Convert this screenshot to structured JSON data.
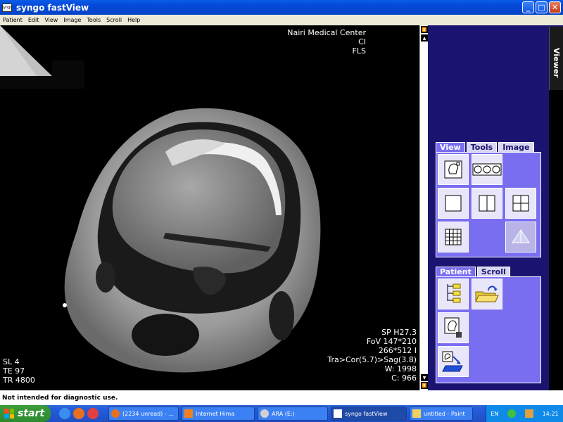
{
  "window": {
    "title": "syngo fastView",
    "icon_label": "syngo"
  },
  "window_controls": {
    "minimize": "_",
    "maximize": "□",
    "close": "✕"
  },
  "menu": [
    "Patient",
    "Edit",
    "View",
    "Image",
    "Tools",
    "Scroll",
    "Help"
  ],
  "overlay": {
    "top_right": [
      "Nairi Medical Center",
      "CI",
      "FLS"
    ],
    "bottom_left": [
      "SL 4",
      "TE 97",
      "TR 4800"
    ],
    "bottom_right": [
      "SP H27.3",
      "FoV 147*210",
      "266*512 I",
      "Tra>Cor(5.7)>Sag(3.8)",
      "W: 1998",
      "C: 966"
    ]
  },
  "viewer_tab": "Viewer",
  "view_panel": {
    "tabs": [
      "View",
      "Tools",
      "Image"
    ],
    "active_tab": "View",
    "tools": [
      "single-image-icon",
      "multi-image-icon",
      "layout-1x1-icon",
      "layout-1x2-icon",
      "layout-2x2-icon",
      "layout-4x4-icon",
      "volume-icon"
    ]
  },
  "patient_panel": {
    "tabs": [
      "Patient",
      "Scroll"
    ],
    "active_tab": "Patient",
    "tools": [
      "patient-browser-icon",
      "open-folder-icon",
      "save-image-icon",
      "export-icon"
    ]
  },
  "status": {
    "text": "Not intended for diagnostic use."
  },
  "taskbar": {
    "start": "start",
    "buttons": [
      "(2234 unread) - ...",
      "Internet Hima",
      "ARA (E:)",
      "syngo fastView",
      "untitled - Paint"
    ],
    "active": "syngo fastView",
    "lang": "EN",
    "clock": "14:21"
  },
  "colors": {
    "accent": "#0548d8",
    "panel": "#7a6ef0",
    "panel_bg": "#1a1470"
  }
}
